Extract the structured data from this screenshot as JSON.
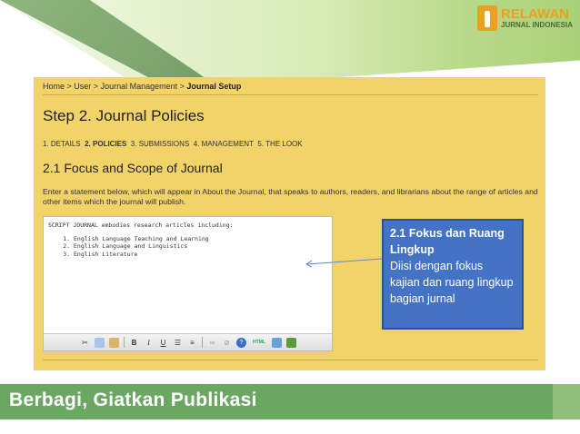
{
  "brand": {
    "line1": "RELAWAN",
    "line2": "JURNAL INDONESIA",
    "accent": "#e9a21f"
  },
  "breadcrumb": {
    "items": [
      "Home",
      "User",
      "Journal Management"
    ],
    "current": "Journal Setup",
    "sep": " > "
  },
  "step_title": "Step 2. Journal Policies",
  "steps": [
    {
      "label": "1. DETAILS",
      "active": false
    },
    {
      "label": "2. POLICIES",
      "active": true
    },
    {
      "label": "3. SUBMISSIONS",
      "active": false
    },
    {
      "label": "4. MANAGEMENT",
      "active": false
    },
    {
      "label": "5. THE LOOK",
      "active": false
    }
  ],
  "section_title": "2.1 Focus and Scope of Journal",
  "description": "Enter a statement below, which will appear in About the Journal, that speaks to authors, readers, and librarians about the range of articles and other items which the journal will publish.",
  "editor": {
    "intro": "SCRIPT JOURNAL embodies research articles including:",
    "items": [
      "English Language Teaching and Learning",
      "English Language and Linguistics",
      "English Literature"
    ],
    "toolbar": [
      "cut-icon",
      "copy-icon",
      "paste-icon",
      "bold-icon",
      "italic-icon",
      "underline-icon",
      "bullet-list-icon",
      "number-list-icon",
      "link-icon",
      "unlink-icon",
      "help-icon",
      "html-icon",
      "image-icon",
      "media-icon"
    ],
    "toolbar_b": "B",
    "toolbar_i": "I",
    "toolbar_u": "U",
    "toolbar_html": "HTML"
  },
  "callout": {
    "heading": "2.1 Fokus dan Ruang Lingkup",
    "body": "Diisi dengan fokus kajian dan ruang lingkup bagian jurnal",
    "color": "#4472c4"
  },
  "footer_title": "Berbagi, Giatkan Publikasi"
}
